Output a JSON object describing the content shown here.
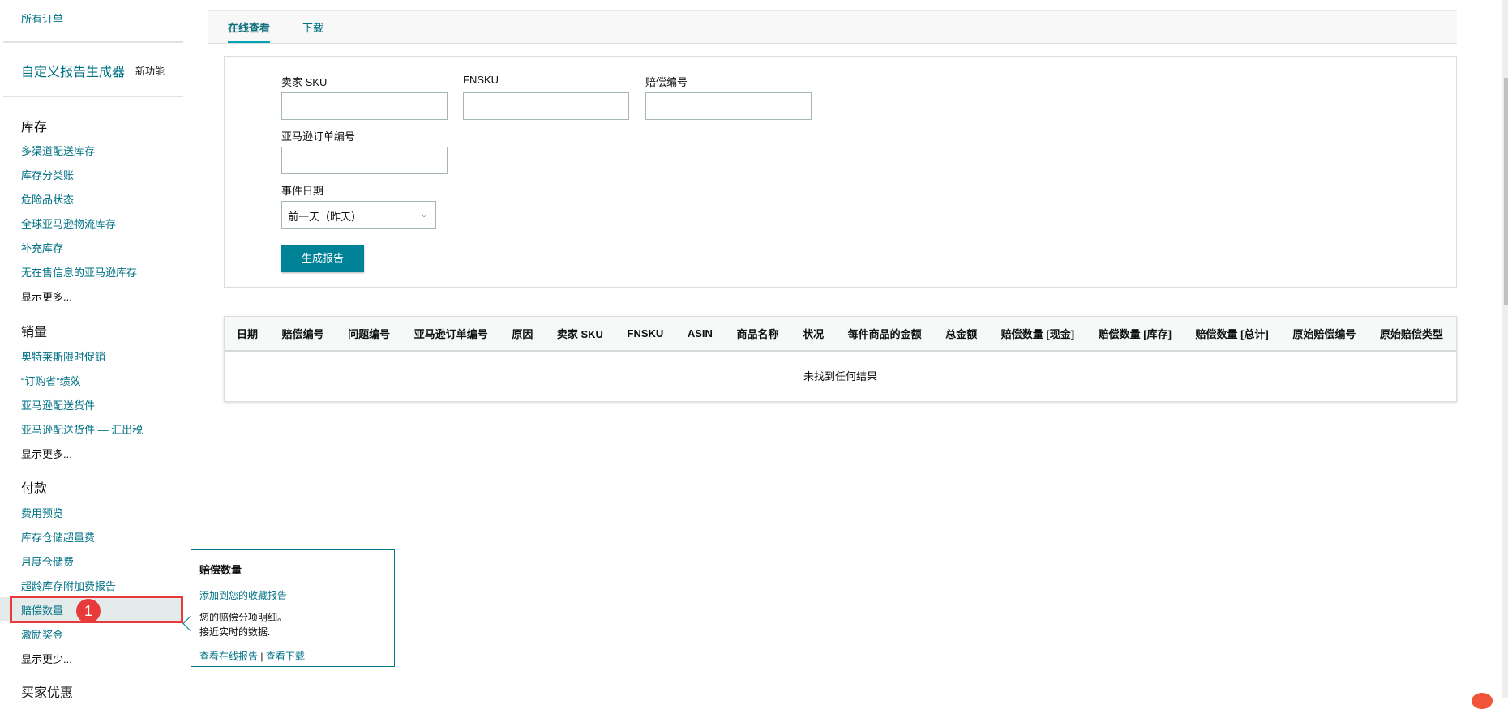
{
  "sidebar": {
    "all_orders": "所有订单",
    "custom_report": "自定义报告生成器",
    "new_feature": "新功能",
    "inventory": {
      "title": "库存",
      "items": [
        "多渠道配送库存",
        "库存分类账",
        "危险品状态",
        "全球亚马逊物流库存",
        "补充库存",
        "无在售信息的亚马逊库存"
      ],
      "more": "显示更多..."
    },
    "sales": {
      "title": "销量",
      "items": [
        "奥特莱斯限时促销",
        "“订购省”绩效",
        "亚马逊配送货件",
        "亚马逊配送货件 — 汇出税"
      ],
      "more": "显示更多..."
    },
    "payments": {
      "title": "付款",
      "items": [
        "费用预览",
        "库存仓储超量费",
        "月度仓储费",
        "超龄库存附加费报告",
        "赔偿数量",
        "激励奖金"
      ],
      "less": "显示更少..."
    },
    "buyer_deals": "买家优惠",
    "badge": "1"
  },
  "tooltip": {
    "title": "赔偿数量",
    "add_favorite": "添加到您的收藏报告",
    "desc1": "您的赔偿分项明细。",
    "desc2": "接近实时的数据.",
    "view_online": "查看在线报告",
    "separator": "|",
    "view_download": "查看下载"
  },
  "tabs": [
    "在线查看",
    "下载"
  ],
  "form": {
    "seller_sku": "卖家 SKU",
    "fnsku": "FNSKU",
    "reimb_id": "赔偿编号",
    "order_id": "亚马逊订单编号",
    "event_date": "事件日期",
    "event_date_value": "前一天（昨天）",
    "generate": "生成报告"
  },
  "table": {
    "headers": [
      "日期",
      "赔偿编号",
      "问题编号",
      "亚马逊订单编号",
      "原因",
      "卖家 SKU",
      "FNSKU",
      "ASIN",
      "商品名称",
      "状况",
      "每件商品的金额",
      "总金额",
      "赔偿数量 [现金]",
      "赔偿数量 [库存]",
      "赔偿数量 [总计]",
      "原始赔偿编号",
      "原始赔偿类型"
    ],
    "empty": "未找到任何结果"
  }
}
